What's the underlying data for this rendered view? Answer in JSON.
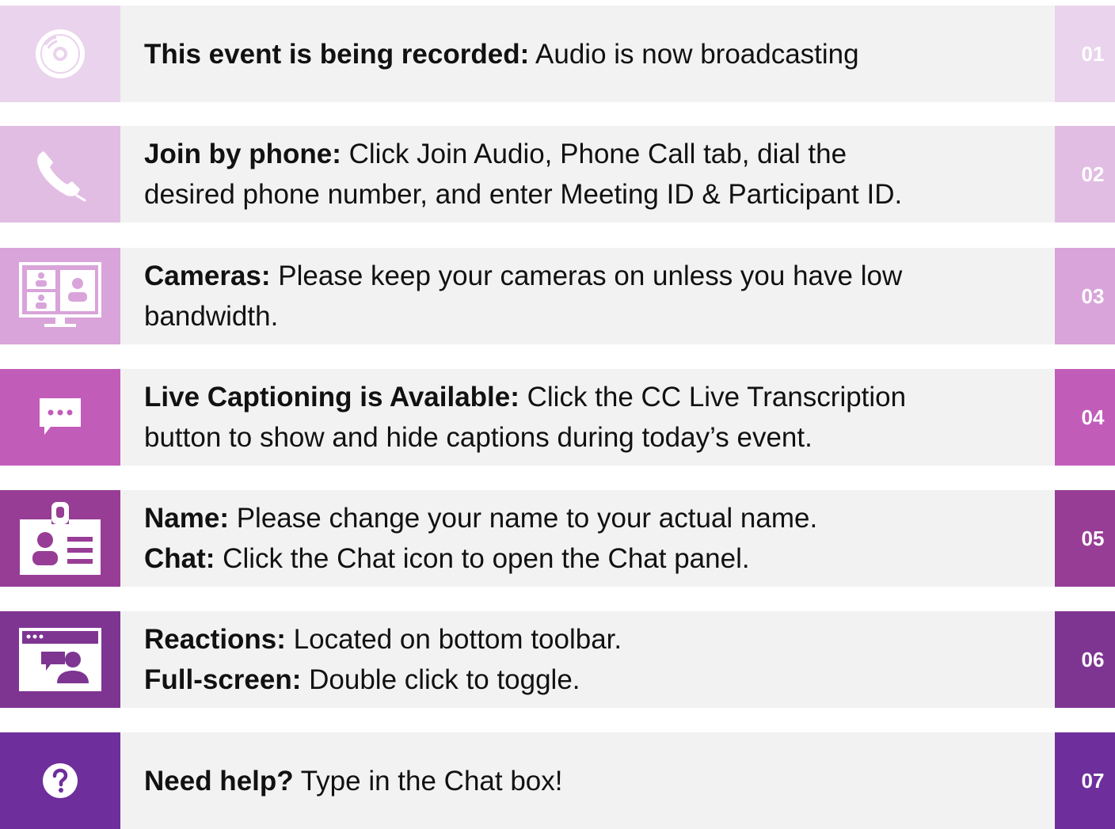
{
  "items": [
    {
      "number": "01",
      "icon": "disc-icon",
      "color": "#ead3ec",
      "lines": [
        {
          "bold": "This event is being recorded:",
          "text": " Audio is now broadcasting"
        }
      ]
    },
    {
      "number": "02",
      "icon": "phone-icon",
      "color": "#e2bde3",
      "lines": [
        {
          "bold": "Join by phone:",
          "text": " Click Join Audio, Phone Call tab, dial the"
        },
        {
          "bold": "",
          "text": "desired phone number, and enter Meeting ID & Participant ID."
        }
      ]
    },
    {
      "number": "03",
      "icon": "video-monitor-icon",
      "color": "#d9a4da",
      "lines": [
        {
          "bold": "Cameras:",
          "text": " Please keep your cameras on unless you have low"
        },
        {
          "bold": "",
          "text": "bandwidth."
        }
      ]
    },
    {
      "number": "04",
      "icon": "chat-bubble-icon",
      "color": "#c25cb9",
      "lines": [
        {
          "bold": "Live Captioning is Available:",
          "text": " Click the CC Live Transcription"
        },
        {
          "bold": "",
          "text": "button to show and hide captions during today’s event."
        }
      ]
    },
    {
      "number": "05",
      "icon": "id-badge-icon",
      "color": "#983d95",
      "lines": [
        {
          "bold": "Name:",
          "text": " Please change your name to your actual name."
        },
        {
          "bold": "Chat:",
          "text": " Click the Chat icon to open the Chat panel."
        }
      ]
    },
    {
      "number": "06",
      "icon": "video-chat-window-icon",
      "color": "#7e3592",
      "lines": [
        {
          "bold": "Reactions:",
          "text": " Located on bottom toolbar."
        },
        {
          "bold": "Full-screen:",
          "text": " Double click to toggle."
        }
      ]
    },
    {
      "number": "07",
      "icon": "question-circle-icon",
      "color": "#6e2e9c",
      "lines": [
        {
          "bold": "Need help?",
          "text": " Type in the Chat box!"
        }
      ]
    }
  ]
}
